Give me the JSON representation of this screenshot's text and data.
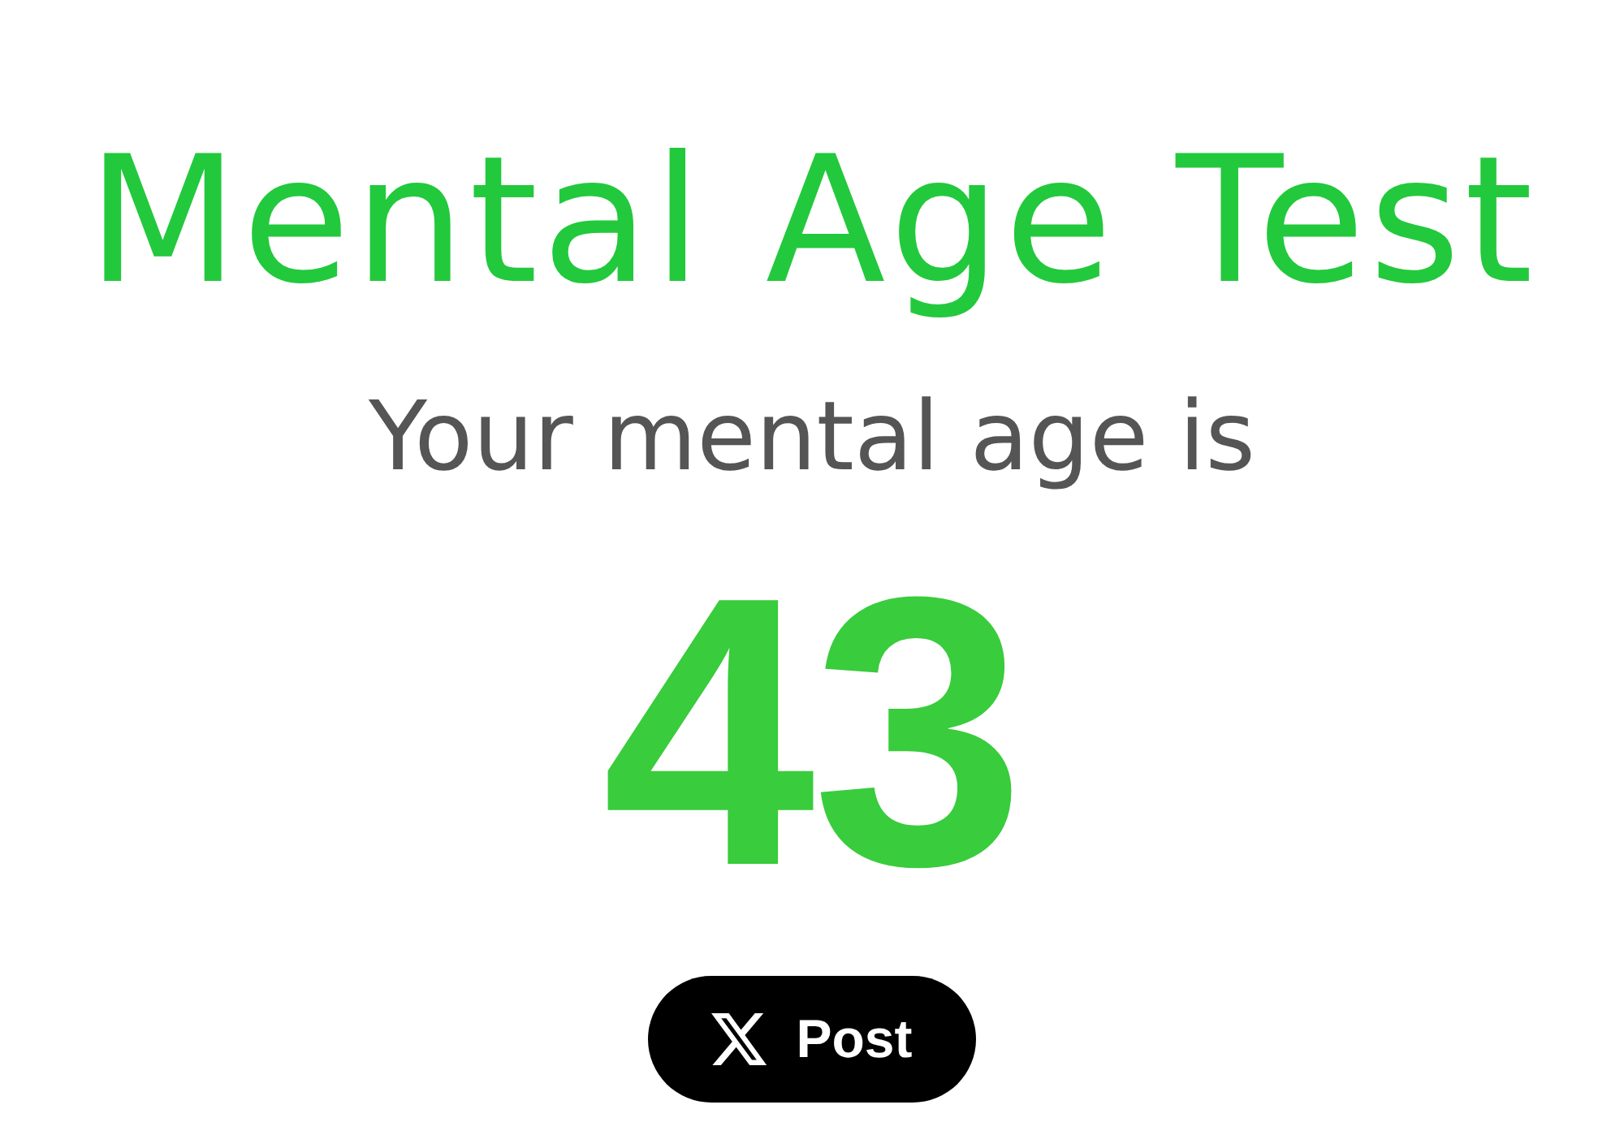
{
  "title": "Mental Age Test",
  "subtitle": "Your mental age is",
  "result": "43",
  "share_button": {
    "label": "Post"
  }
}
